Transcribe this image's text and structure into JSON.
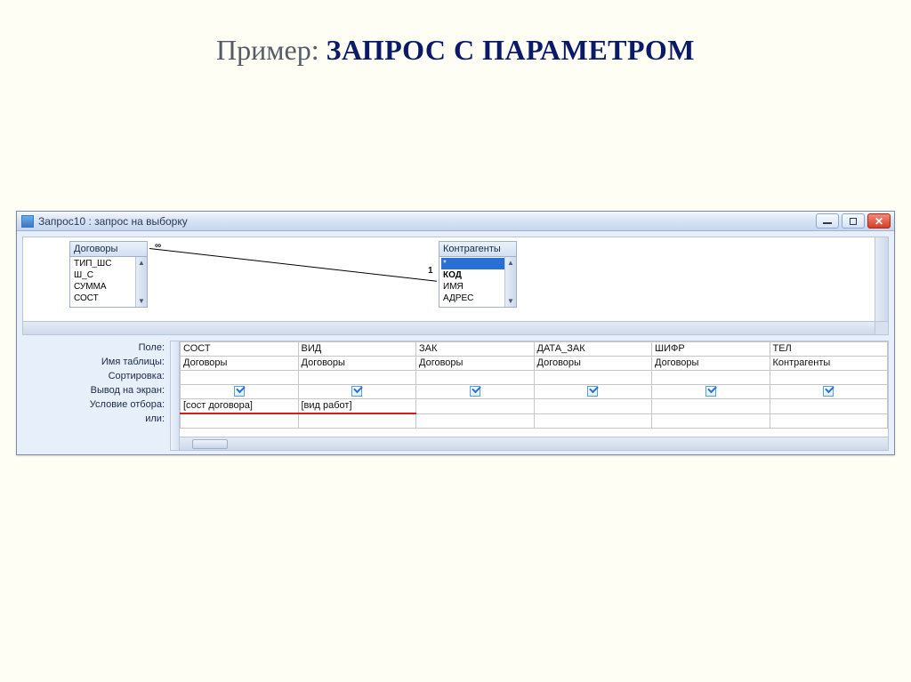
{
  "slide": {
    "prefix": "Пример:  ",
    "title_main": "ЗАПРОС С ПАРАМЕТРОМ"
  },
  "window": {
    "title": "Запрос10 : запрос на выборку"
  },
  "tables": {
    "left": {
      "title": "Договоры",
      "fields": [
        "ТИП_ШС",
        "Ш_С",
        "СУММА",
        "СОСТ"
      ]
    },
    "right": {
      "title": "Контрагенты",
      "fields": [
        "*",
        "КОД",
        "ИМЯ",
        "АДРЕС"
      ]
    },
    "relation": {
      "left_card": "∞",
      "right_card": "1"
    }
  },
  "grid": {
    "row_labels": [
      "Поле:",
      "Имя таблицы:",
      "Сортировка:",
      "Вывод на экран:",
      "Условие отбора:",
      "или:"
    ],
    "columns": [
      {
        "field": "СОСТ",
        "table": "Договоры",
        "sort": "",
        "criteria": "[сост договора]",
        "criteria_red": true
      },
      {
        "field": "ВИД",
        "table": "Договоры",
        "sort": "",
        "criteria": "[вид работ]",
        "criteria_red": true
      },
      {
        "field": "ЗАК",
        "table": "Договоры",
        "sort": "",
        "criteria": ""
      },
      {
        "field": "ДАТА_ЗАК",
        "table": "Договоры",
        "sort": "",
        "criteria": ""
      },
      {
        "field": "ШИФР",
        "table": "Договоры",
        "sort": "",
        "criteria": ""
      },
      {
        "field": "ТЕЛ",
        "table": "Контрагенты",
        "sort": "",
        "criteria": ""
      }
    ]
  }
}
